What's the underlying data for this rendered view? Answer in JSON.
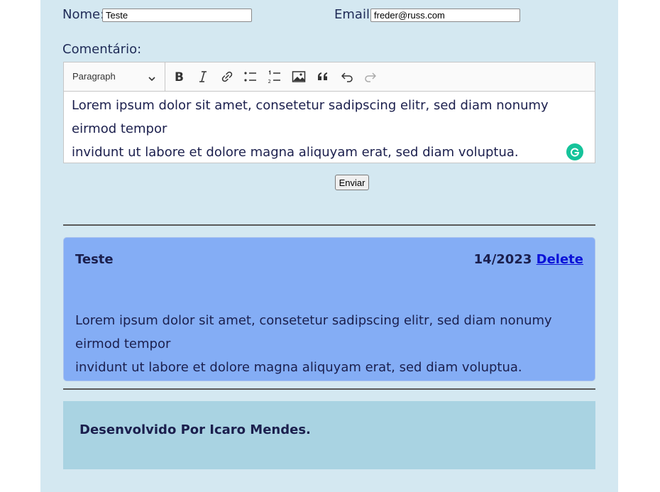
{
  "form": {
    "name_label": "Nome:",
    "name_value": "Teste",
    "email_label": "Email:",
    "email_value": "freder@russ.com",
    "comment_label": "Comentário:",
    "submit_label": "Enviar"
  },
  "editor": {
    "block_format": "Paragraph",
    "toolbar_icons": [
      "bold-icon",
      "italic-icon",
      "link-icon",
      "bulleted-list-icon",
      "numbered-list-icon",
      "image-icon",
      "blockquote-icon",
      "undo-icon",
      "redo-icon"
    ],
    "content_line1": "Lorem ipsum dolor sit amet, consetetur sadipscing elitr, sed diam nonumy eirmod tempor",
    "content_line2": "invidunt ut labore et dolore magna aliquyam erat, sed diam voluptua."
  },
  "comments": [
    {
      "name": "Teste",
      "date": "14/2023",
      "delete_label": "Delete",
      "body_line1": "Lorem ipsum dolor sit amet, consetetur sadipscing elitr, sed diam nonumy eirmod tempor",
      "body_line2": "invidunt ut labore et dolore magna aliquyam erat, sed diam voluptua."
    }
  ],
  "footer": {
    "text": "Desenvolvido Por Icaro Mendes."
  },
  "colors": {
    "page_background": "#d4e8f1",
    "comment_card": "#84adf5",
    "footer_background": "#a9d3e2",
    "text_navy": "#1b1f4d",
    "link_blue": "#0b12d8",
    "grammarly_green": "#15c39a"
  }
}
